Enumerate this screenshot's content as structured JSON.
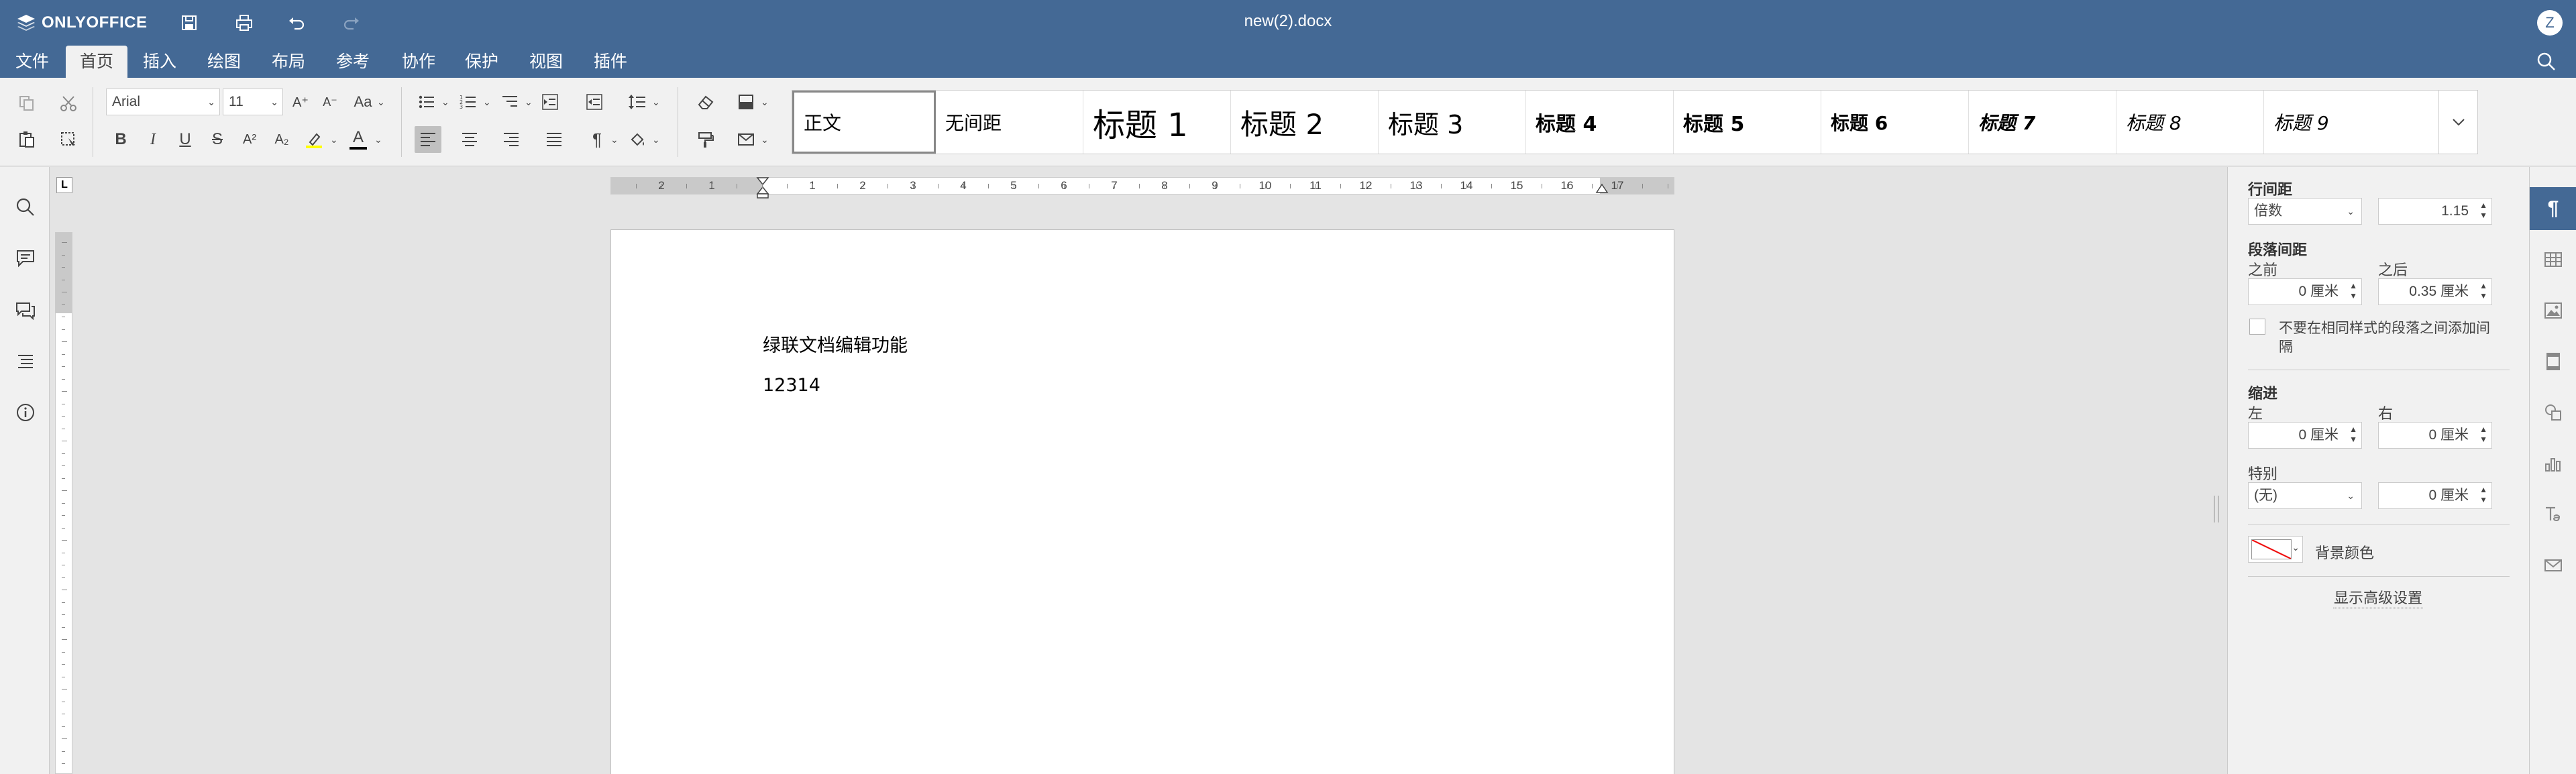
{
  "app": {
    "brand": "ONLYOFFICE",
    "doc_title": "new(2).docx",
    "user_initial": "Z"
  },
  "menu_tabs": [
    "文件",
    "首页",
    "插入",
    "绘图",
    "布局",
    "参考",
    "协作",
    "保护",
    "视图",
    "插件"
  ],
  "active_tab": "首页",
  "toolbar": {
    "font_name": "Arial",
    "font_size": "11",
    "font_size_increase": "A⁺",
    "font_size_decrease": "A⁻",
    "change_case": "Aa",
    "bold": "B",
    "italic": "I",
    "underline": "U",
    "strikethrough": "S",
    "superscript": "A²",
    "subscript": "A₂",
    "font_color": "A"
  },
  "style_gallery": [
    "正文",
    "无间距",
    "标题 1",
    "标题 2",
    "标题 3",
    "标题 4",
    "标题 5",
    "标题 6",
    "标题 7",
    "标题 8",
    "标题 9"
  ],
  "active_style": "正文",
  "ruler": {
    "corner": "L",
    "numbers": [
      "2",
      "1",
      "1",
      "2",
      "3",
      "4",
      "5",
      "6",
      "7",
      "8",
      "9",
      "10",
      "11",
      "12",
      "13",
      "14",
      "15",
      "16",
      "17"
    ]
  },
  "document": {
    "lines": [
      "绿联文档编辑功能",
      "12314"
    ]
  },
  "paragraph_settings": {
    "line_spacing_label": "行间距",
    "line_spacing_type": "倍数",
    "line_spacing_value": "1.15",
    "paragraph_spacing_label": "段落间距",
    "before_label": "之前",
    "after_label": "之后",
    "before_value": "0 厘米",
    "after_value": "0.35 厘米",
    "no_space_checkbox_label_1": "不要在相同样式的段落之间添加间",
    "no_space_checkbox_label_2": "隔",
    "no_space_checked": false,
    "indent_label": "缩进",
    "left_label": "左",
    "right_label": "右",
    "left_value": "0 厘米",
    "right_value": "0 厘米",
    "special_label": "特别",
    "special_type": "(无)",
    "special_value": "0 厘米",
    "background_color_label": "背景颜色",
    "advanced_link": "显示高级设置"
  },
  "colors": {
    "header_bg": "#446995",
    "toolbar_bg": "#f1f1f1",
    "workspace_bg": "#e4e4e4",
    "highlight_yellow": "#ffff00",
    "font_color_bar": "#000000",
    "bg_color_none_line": "#e00000"
  },
  "icons": {
    "quick_access": [
      "save-icon",
      "print-icon",
      "undo-icon",
      "redo-icon"
    ],
    "left_panel": [
      "search-icon",
      "comments-icon",
      "chat-icon",
      "navigation-icon",
      "about-icon"
    ],
    "right_panel": [
      "paragraph-icon",
      "table-icon",
      "image-icon",
      "header-footer-icon",
      "shape-icon",
      "chart-icon",
      "text-art-icon",
      "mail-merge-icon"
    ]
  }
}
